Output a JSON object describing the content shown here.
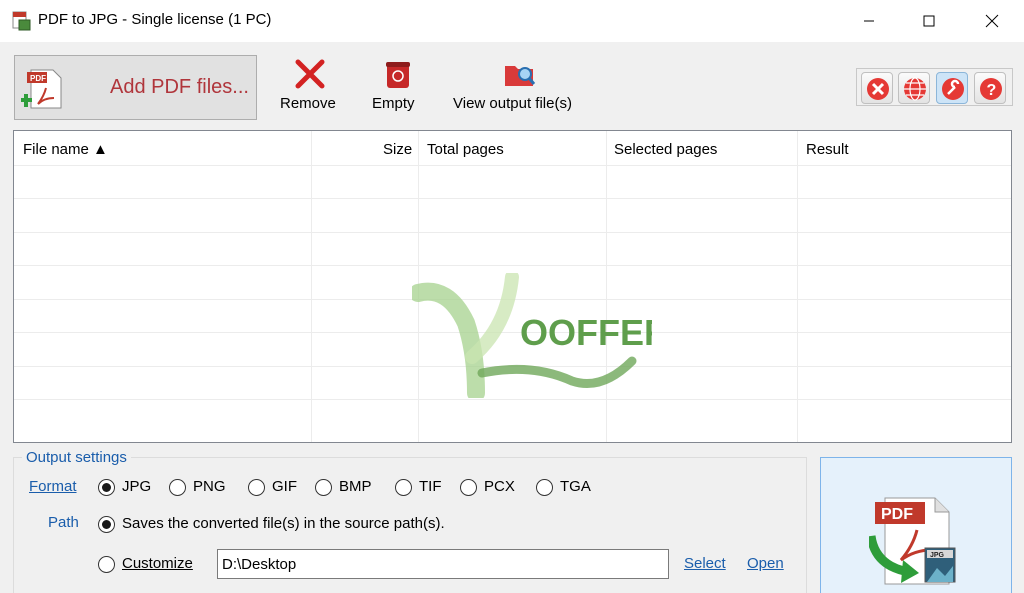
{
  "window": {
    "title": "PDF to JPG - Single license (1 PC)"
  },
  "toolbar": {
    "add_label": "Add PDF files...",
    "remove_label": "Remove",
    "empty_label": "Empty",
    "view_output_label": "View output file(s)"
  },
  "right_tools": [
    "close-red-icon",
    "globe-icon",
    "wrench-icon",
    "help-icon"
  ],
  "table": {
    "columns": [
      "File name ▲",
      "Size",
      "Total pages",
      "Selected pages",
      "Result"
    ],
    "rows": []
  },
  "watermark": {
    "text": "OOFFERS"
  },
  "output_settings": {
    "title": "Output settings",
    "format_label": "Format",
    "formats": [
      "JPG",
      "PNG",
      "GIF",
      "BMP",
      "TIF",
      "PCX",
      "TGA"
    ],
    "selected_format": "JPG",
    "path_label": "Path",
    "source_path_option": "Saves the converted file(s) in the source path(s).",
    "customize_label": "Customize",
    "custom_path_value": "D:\\Desktop",
    "select_link": "Select",
    "open_link": "Open"
  },
  "convert": {
    "icon_text_pdf": "PDF",
    "icon_text_jpg": "JPG"
  },
  "colors": {
    "accent": "#1a5dab",
    "add_label": "#b0353b",
    "convert_bg": "#e5f1fb"
  }
}
